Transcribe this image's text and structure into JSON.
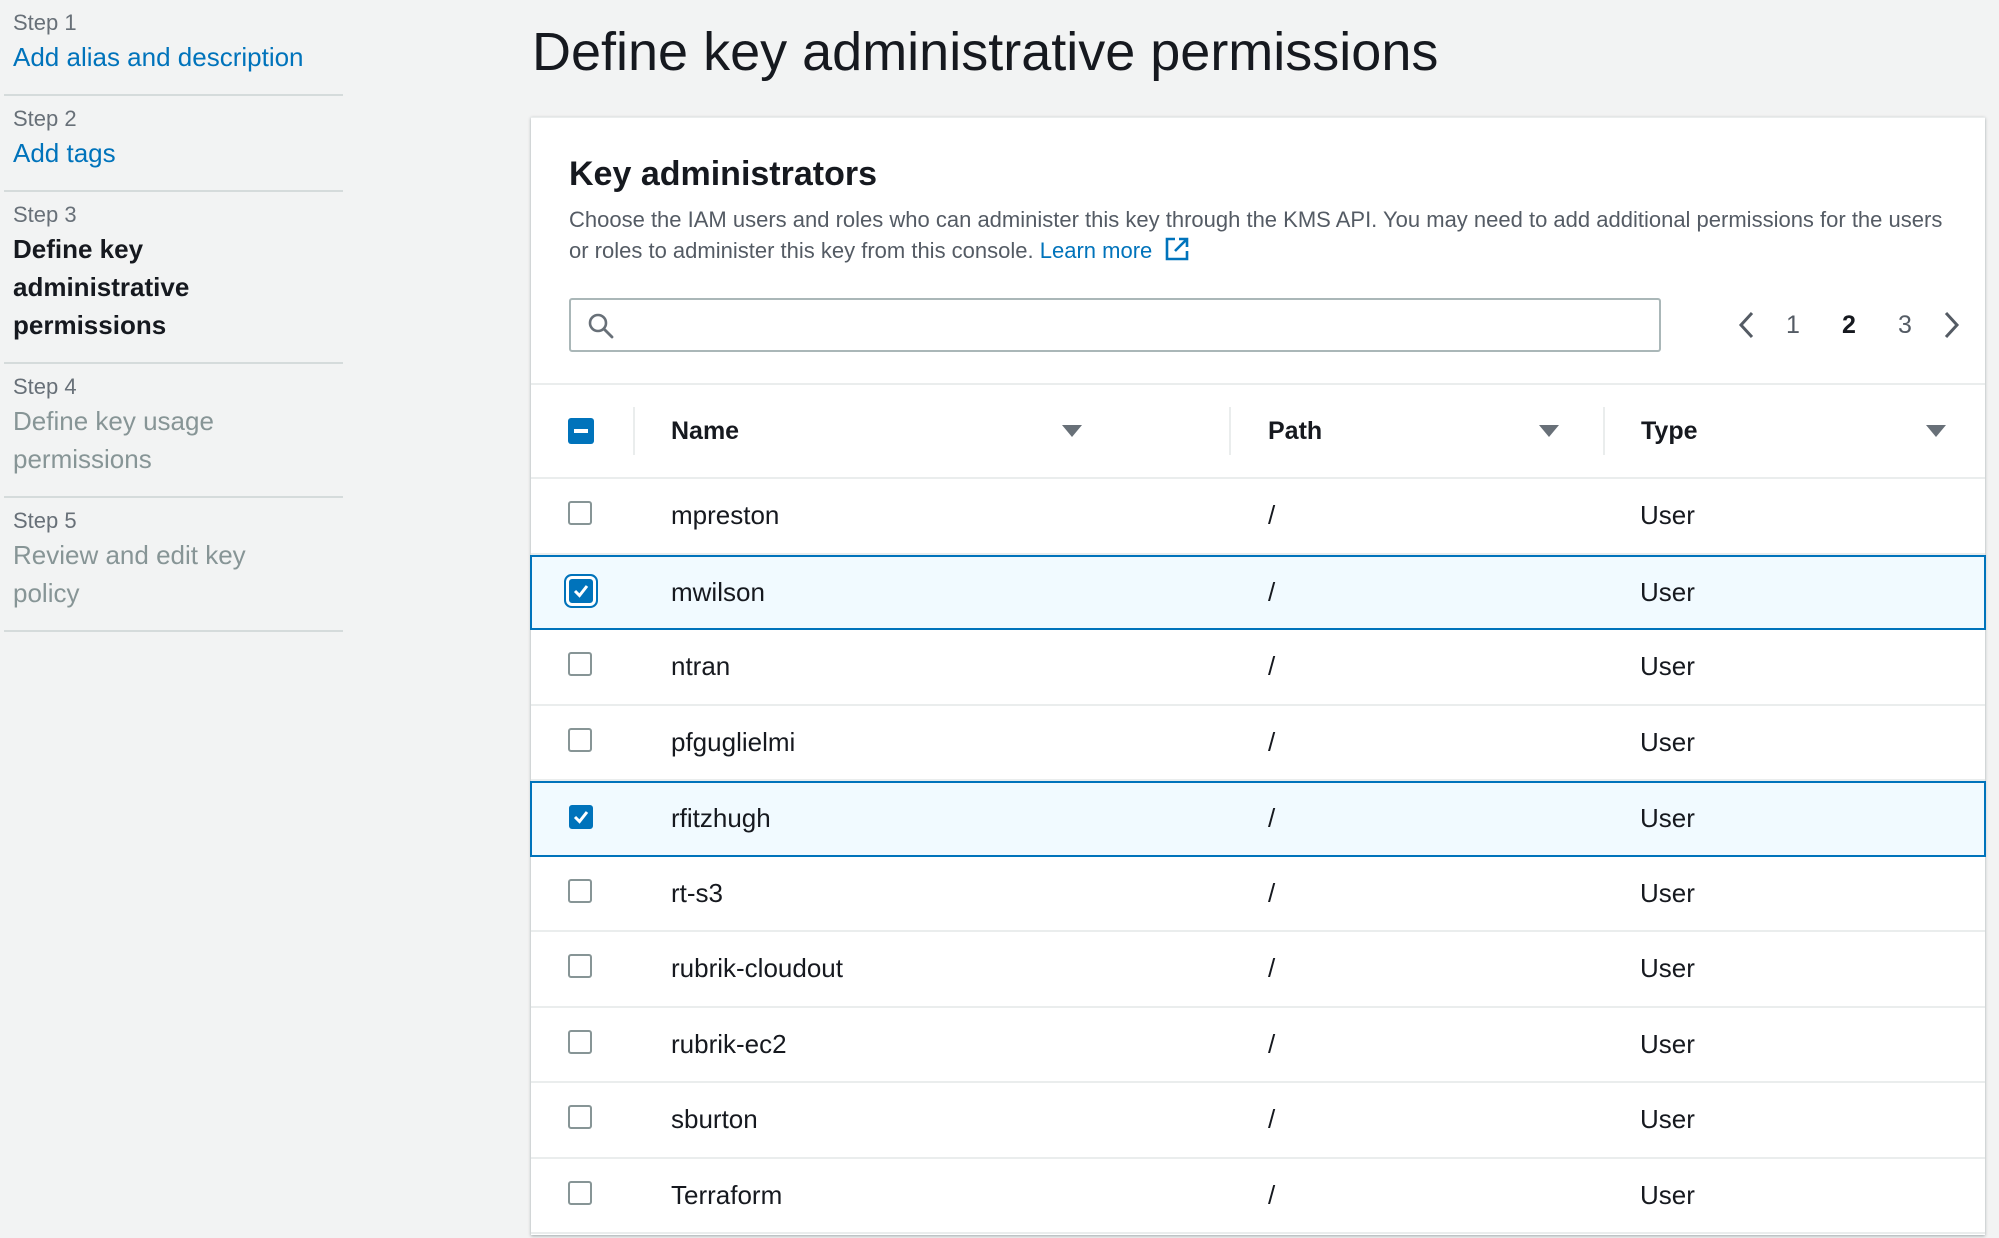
{
  "sidebar": {
    "steps": [
      {
        "num": "Step 1",
        "title": "Add alias and description"
      },
      {
        "num": "Step 2",
        "title": "Add tags"
      },
      {
        "num": "Step 3",
        "title": "Define key administrative permissions"
      },
      {
        "num": "Step 4",
        "title": "Define key usage permissions"
      },
      {
        "num": "Step 5",
        "title": "Review and edit key policy"
      }
    ]
  },
  "page": {
    "title": "Define key administrative permissions"
  },
  "panel": {
    "title": "Key administrators",
    "description": "Choose the IAM users and roles who can administer this key through the KMS API. You may need to add additional permissions for the users or roles to administer this key from this console.",
    "learn_more": "Learn more"
  },
  "search": {
    "value": "",
    "placeholder": ""
  },
  "pagination": {
    "pages": [
      "1",
      "2",
      "3"
    ],
    "current": "2"
  },
  "table": {
    "headers": {
      "name": "Name",
      "path": "Path",
      "type": "Type"
    },
    "rows": [
      {
        "name": "mpreston",
        "path": "/",
        "type": "User",
        "checked": false
      },
      {
        "name": "mwilson",
        "path": "/",
        "type": "User",
        "checked": true
      },
      {
        "name": "ntran",
        "path": "/",
        "type": "User",
        "checked": false
      },
      {
        "name": "pfguglielmi",
        "path": "/",
        "type": "User",
        "checked": false
      },
      {
        "name": "rfitzhugh",
        "path": "/",
        "type": "User",
        "checked": true
      },
      {
        "name": "rt-s3",
        "path": "/",
        "type": "User",
        "checked": false
      },
      {
        "name": "rubrik-cloudout",
        "path": "/",
        "type": "User",
        "checked": false
      },
      {
        "name": "rubrik-ec2",
        "path": "/",
        "type": "User",
        "checked": false
      },
      {
        "name": "sburton",
        "path": "/",
        "type": "User",
        "checked": false
      },
      {
        "name": "Terraform",
        "path": "/",
        "type": "User",
        "checked": false
      }
    ]
  },
  "colors": {
    "accent": "#0073bb",
    "selected_row_bg": "#f1faff",
    "page_bg": "#f2f3f3"
  }
}
